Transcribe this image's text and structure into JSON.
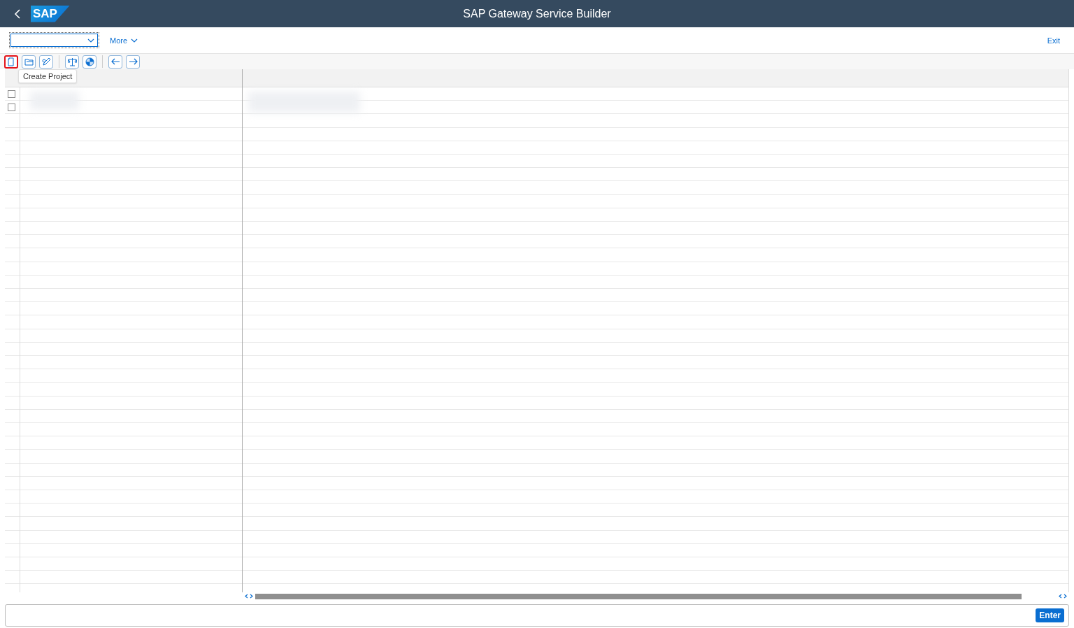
{
  "header": {
    "title": "SAP Gateway Service Builder",
    "logo": "SAP"
  },
  "action_bar": {
    "more": "More",
    "exit": "Exit"
  },
  "toolbar": {
    "groups": [
      [
        {
          "kind": "document",
          "highlighted": true
        },
        {
          "kind": "folder",
          "highlighted": false
        },
        {
          "kind": "edit",
          "highlighted": false
        }
      ],
      [
        {
          "kind": "balance",
          "highlighted": false
        },
        {
          "kind": "pie",
          "highlighted": false
        }
      ],
      [
        {
          "kind": "arrow-left",
          "highlighted": false
        },
        {
          "kind": "arrow-right",
          "highlighted": false
        }
      ]
    ],
    "tooltip": "Create Project"
  },
  "tree": {
    "rows": [
      {
        "checked": false
      },
      {
        "checked": false
      }
    ]
  },
  "command_bar": {
    "button": "Enter"
  }
}
